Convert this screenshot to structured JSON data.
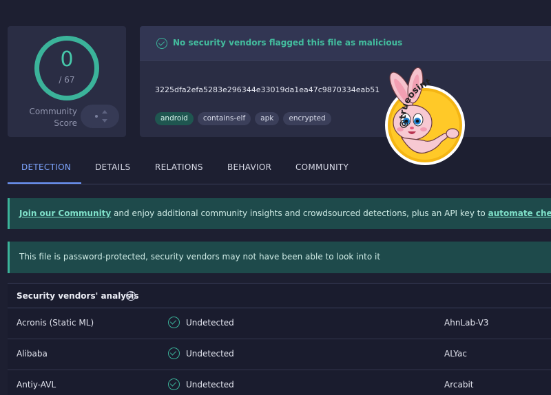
{
  "score": {
    "detections": "0",
    "total": "/ 67",
    "community_label_line1": "Community",
    "community_label_line2": "Score"
  },
  "summary": {
    "status": "No security vendors flagged this file as malicious",
    "hash": "3225dfa2efa5283e296344e33019da1ea47c9870334eab51",
    "tags": [
      "android",
      "contains-elf",
      "apk",
      "encrypted"
    ]
  },
  "sticker": {
    "handle": "@trueosint"
  },
  "tabs": [
    "DETECTION",
    "DETAILS",
    "RELATIONS",
    "BEHAVIOR",
    "COMMUNITY"
  ],
  "active_tab": "DETECTION",
  "banners": {
    "community_link": "Join our Community",
    "community_text": " and enjoy additional community insights and crowdsourced detections, plus an API key to ",
    "automate_link": "automate checks.",
    "password_text": "This file is password-protected, security vendors may not have been able to look into it"
  },
  "analysis": {
    "title": "Security vendors' analysis",
    "info_glyph": "i",
    "rows": [
      {
        "vendor": "Acronis (Static ML)",
        "status": "Undetected",
        "vendor2": "AhnLab-V3"
      },
      {
        "vendor": "Alibaba",
        "status": "Undetected",
        "vendor2": "ALYac"
      },
      {
        "vendor": "Antiy-AVL",
        "status": "Undetected",
        "vendor2": "Arcabit"
      }
    ]
  },
  "colors": {
    "background": "#1d1f31",
    "card": "#2a2d44",
    "accent_green": "#3bb39a",
    "accent_blue": "#6f99ff",
    "banner": "#1e4a4b"
  },
  "icons": {
    "status": "check-circle-icon",
    "info": "info-icon",
    "vote": "vote-arrows-icon"
  }
}
